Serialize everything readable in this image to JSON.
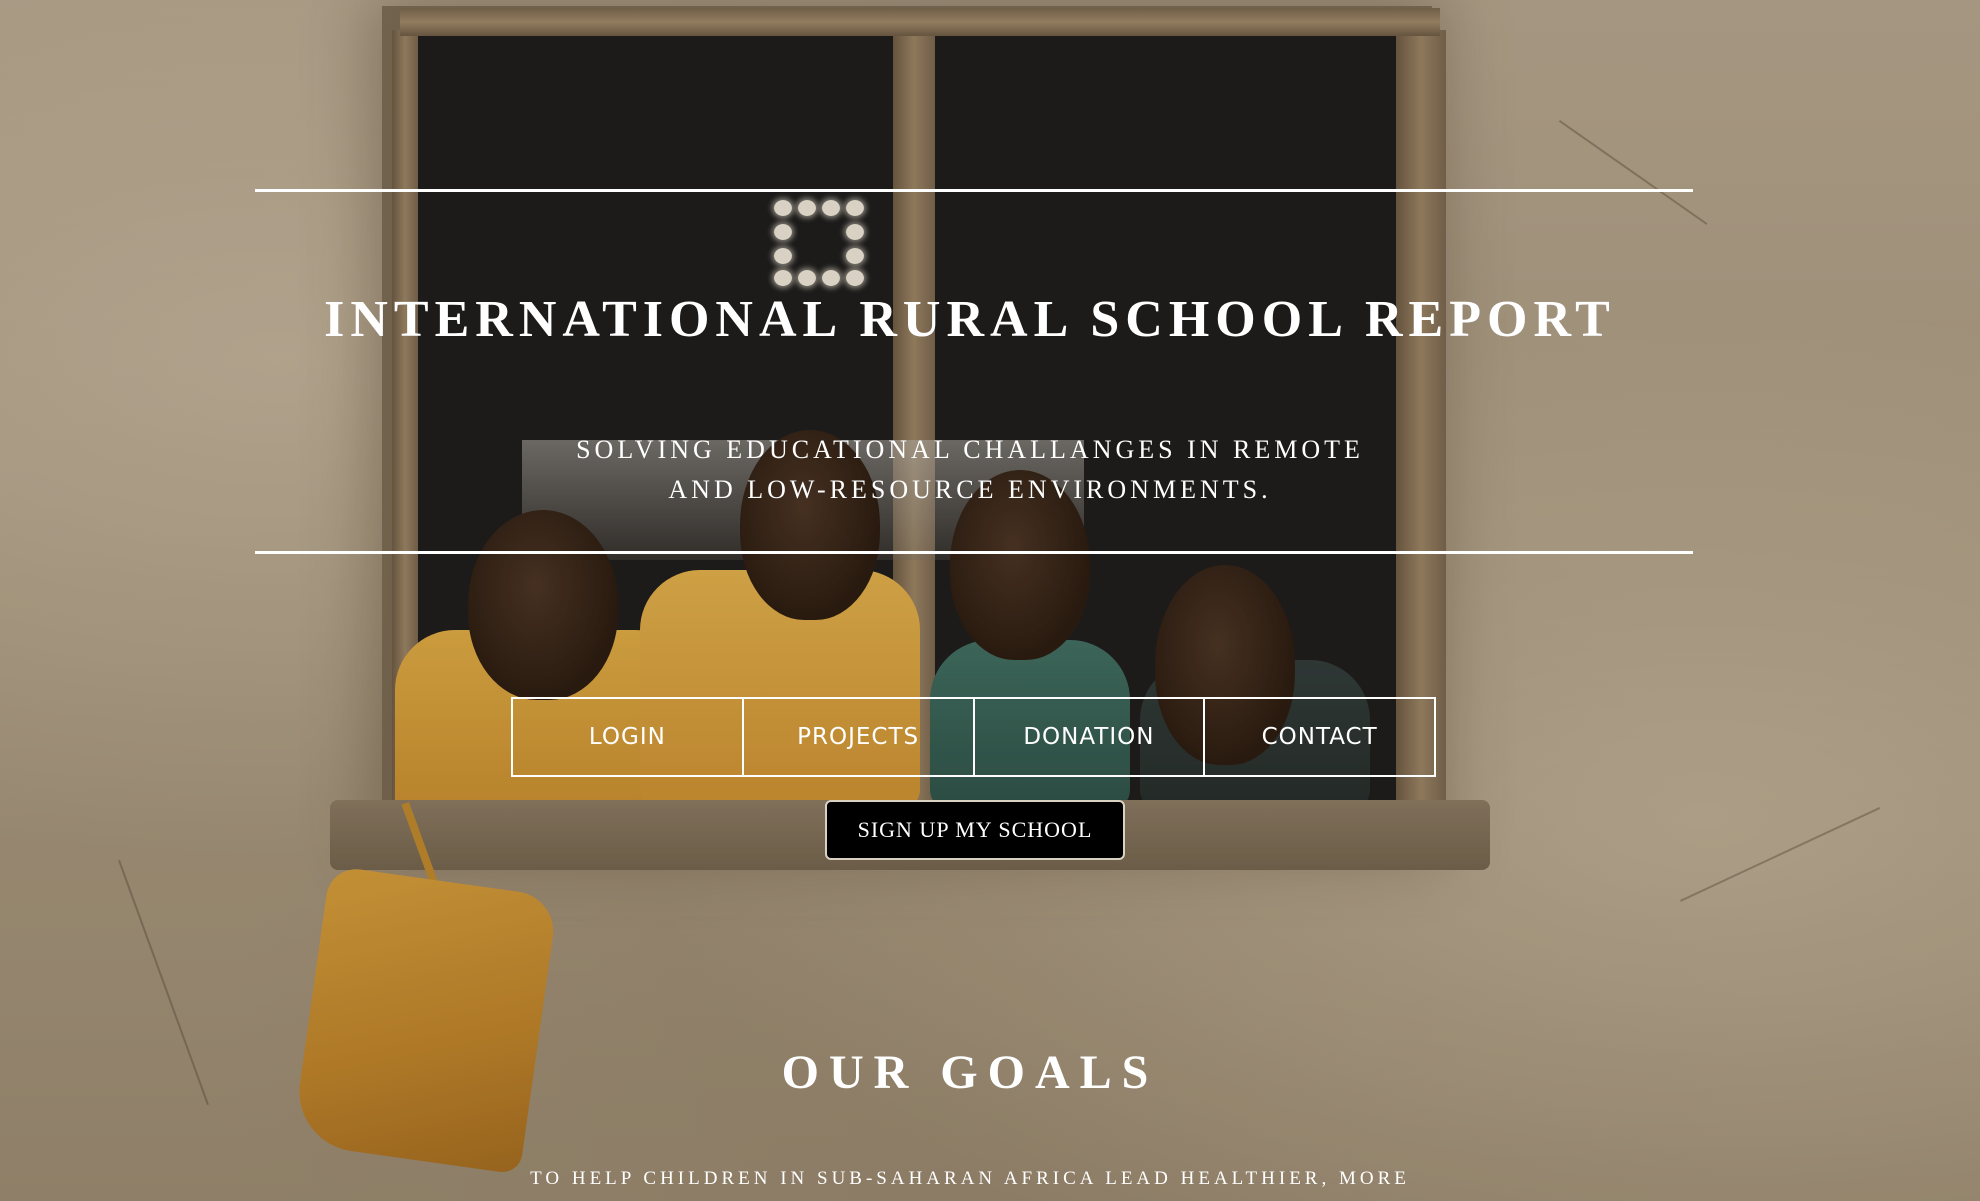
{
  "header": {
    "title": "INTERNATIONAL RURAL SCHOOL REPORT",
    "tagline_line1": "SOLVING EDUCATIONAL CHALLANGES IN REMOTE",
    "tagline_line2": "AND LOW-RESOURCE ENVIRONMENTS.",
    "logo_icon": "dotted-square-logo-icon"
  },
  "nav": {
    "items": [
      {
        "label": "LOGIN"
      },
      {
        "label": "PROJECTS"
      },
      {
        "label": "DONATION"
      },
      {
        "label": "CONTACT"
      }
    ]
  },
  "cta": {
    "signup_label": "SIGN UP MY SCHOOL"
  },
  "goals": {
    "heading": "OUR GOALS",
    "text": "TO HELP CHILDREN IN SUB-SAHARAN AFRICA LEAD HEALTHIER, MORE"
  },
  "colors": {
    "text": "#ffffff",
    "button_bg": "#000000",
    "wall": "#b5a690"
  }
}
